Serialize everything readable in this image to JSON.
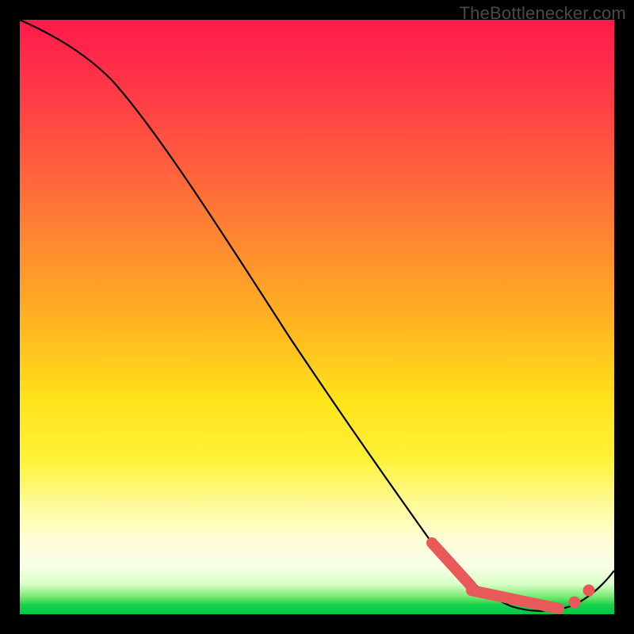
{
  "watermark": "TheBottlenecker.com",
  "chart_data": {
    "type": "line",
    "title": "",
    "xlabel": "",
    "ylabel": "",
    "xlim": [
      0,
      100
    ],
    "ylim": [
      0,
      100
    ],
    "series": [
      {
        "name": "curve",
        "x": [
          0,
          3,
          7,
          12,
          18,
          25,
          32,
          40,
          48,
          56,
          63,
          68,
          72,
          76,
          80,
          84,
          88,
          92,
          96,
          100
        ],
        "y": [
          100,
          99,
          97,
          94,
          89,
          82,
          74,
          64,
          54,
          44,
          34,
          26,
          19,
          12,
          6,
          2,
          0.5,
          1.5,
          5,
          10
        ]
      }
    ],
    "highlight_dots": {
      "comment": "red markers near the curve minimum",
      "left_cluster_x_range": [
        68,
        78
      ],
      "flat_segment_x_range": [
        78,
        90
      ],
      "right_dots_x": [
        93,
        96
      ]
    },
    "background_gradient": {
      "top": "#ff1a4a",
      "mid": "#ffe31a",
      "bottom": "#00c84a"
    }
  }
}
